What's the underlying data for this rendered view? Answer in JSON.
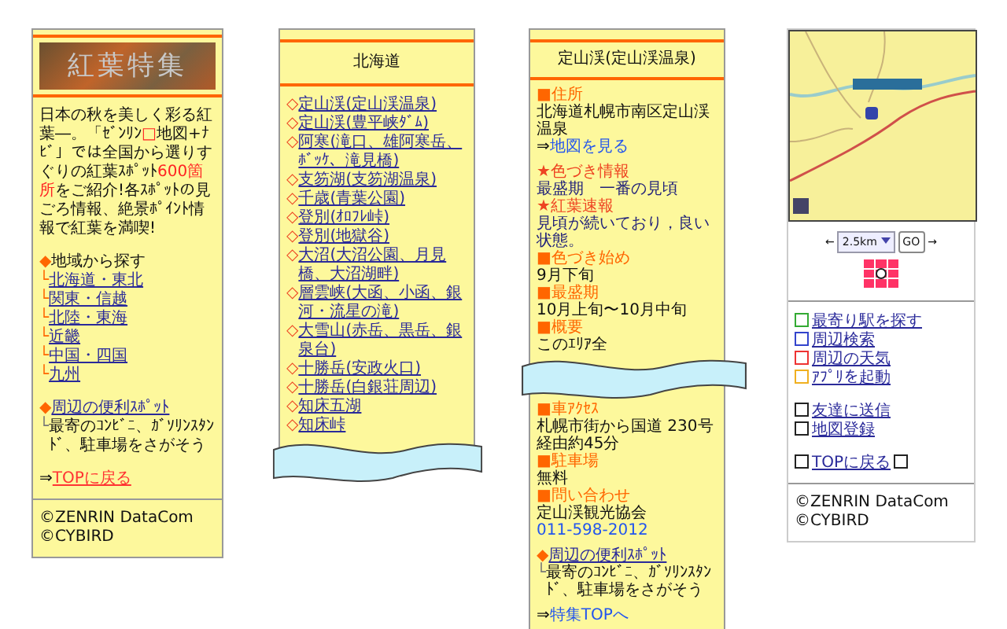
{
  "guide": {
    "banner_title": "紅葉特集",
    "intro": [
      {
        "text": "日本の秋を美しく彩る紅葉―。「ｾﾞﾝﾘﾝ",
        "accent": false
      },
      {
        "text": "□",
        "accent": true
      },
      {
        "text": "地図+ﾅﾋﾞ」では全国から選りすぐりの紅葉ｽﾎﾟｯﾄ",
        "accent": false
      },
      {
        "text": "600箇所",
        "accent": true
      },
      {
        "text": "をご紹介!各ｽﾎﾟｯﾄの見ごろ情報、絶景ﾎﾟｲﾝﾄ情報で紅葉を満喫!",
        "accent": false
      }
    ],
    "section_marker": "◆",
    "section_title": "地域から探す",
    "branch_marker": "└",
    "regions": [
      "北海道・東北",
      "関東・信越",
      "北陸・東海",
      "近畿",
      "中国・四国",
      "九州"
    ],
    "spot_link": "周辺の便利ｽﾎﾟｯﾄ",
    "spot_hint": "最寄のｺﾝﾋﾞﾆ、ｶﾞｿﾘﾝｽﾀﾝﾄﾞ、駐車場をさがそう",
    "arrow": "⇒",
    "top_link": "TOPに戻る",
    "footer": [
      "©ZENRIN DataCom",
      "©CYBIRD"
    ]
  },
  "region": {
    "title": "北海道",
    "marker": "◇",
    "spots": [
      "定山渓(定山渓温泉)",
      "定山渓(豊平峡ﾀﾞﾑ)",
      "阿寒(滝口、雄阿寒岳、ﾎﾞｯｹ、滝見橋)",
      "支笏湖(支笏湖温泉)",
      "千歳(青葉公園)",
      "登別(ｵﾛﾌﾚ峠)",
      "登別(地獄谷)",
      "大沼(大沼公園、月見橋、大沼湖畔)",
      "層雲峡(大函、小函、銀河・流星の滝)",
      "大雪山(赤岳、黒岳、銀泉台)",
      "十勝岳(安政火口)",
      "十勝岳(白銀荘周辺)",
      "知床五湖",
      "知床峠"
    ]
  },
  "detail": {
    "title": "定山渓(定山渓温泉)",
    "entries": [
      {
        "kind": "label",
        "mark": "■",
        "text": "住所"
      },
      {
        "kind": "text",
        "text": "北海道札幌市南区定山渓温泉"
      },
      {
        "kind": "link",
        "mark": "⇒",
        "text": "地図を見る"
      },
      {
        "kind": "gap"
      },
      {
        "kind": "alert",
        "mark": "★",
        "text": "色づき情報"
      },
      {
        "kind": "note",
        "text": "最盛期　一番の見頃"
      },
      {
        "kind": "alert",
        "mark": "★",
        "text": "紅葉速報"
      },
      {
        "kind": "note",
        "text": "見頃が続いており，良い状態。"
      },
      {
        "kind": "label",
        "mark": "■",
        "text": "色づき始め"
      },
      {
        "kind": "text",
        "text": "9月下旬"
      },
      {
        "kind": "label",
        "mark": "■",
        "text": "最盛期"
      },
      {
        "kind": "text",
        "text": "10月上旬〜10月中旬"
      },
      {
        "kind": "label",
        "mark": "■",
        "text": "概要"
      },
      {
        "kind": "text",
        "text": "このｴﾘｱ全"
      },
      {
        "kind": "break"
      },
      {
        "kind": "label",
        "mark": "■",
        "text": "車ｱｸｾｽ"
      },
      {
        "kind": "text",
        "text": "札幌市街から国道 230号経由約45分"
      },
      {
        "kind": "label",
        "mark": "■",
        "text": "駐車場"
      },
      {
        "kind": "text",
        "text": "無料"
      },
      {
        "kind": "label",
        "mark": "■",
        "text": "問い合わせ"
      },
      {
        "kind": "text",
        "text": "定山渓観光協会"
      },
      {
        "kind": "phone",
        "text": "011-598-2012"
      },
      {
        "kind": "gap"
      },
      {
        "kind": "spot",
        "mark": "◆",
        "text": "周辺の便利ｽﾎﾟｯﾄ"
      },
      {
        "kind": "hint",
        "mark": "└",
        "text": "最寄のｺﾝﾋﾞﾆ、ｶﾞｿﾘﾝｽﾀﾝﾄﾞ、駐車場をさがそう"
      },
      {
        "kind": "gap"
      },
      {
        "kind": "link",
        "mark": "⇒",
        "text": "特集TOPへ"
      }
    ]
  },
  "map": {
    "left_arrow": "←",
    "scale": "2.5km",
    "go": "GO",
    "right_arrow": "→",
    "actions": [
      {
        "label": "最寄り駅を探す",
        "color": "#33aa33"
      },
      {
        "label": "周辺検索",
        "color": "#3344cc"
      },
      {
        "label": "周辺の天気",
        "color": "#ee3333"
      },
      {
        "label": "ｱﾌﾟﾘを起動",
        "color": "#f0b020"
      }
    ],
    "tools": [
      "友達に送信",
      "地図登録"
    ],
    "top_link": "TOPに戻る",
    "footer": [
      "©ZENRIN DataCom",
      "©CYBIRD"
    ]
  }
}
